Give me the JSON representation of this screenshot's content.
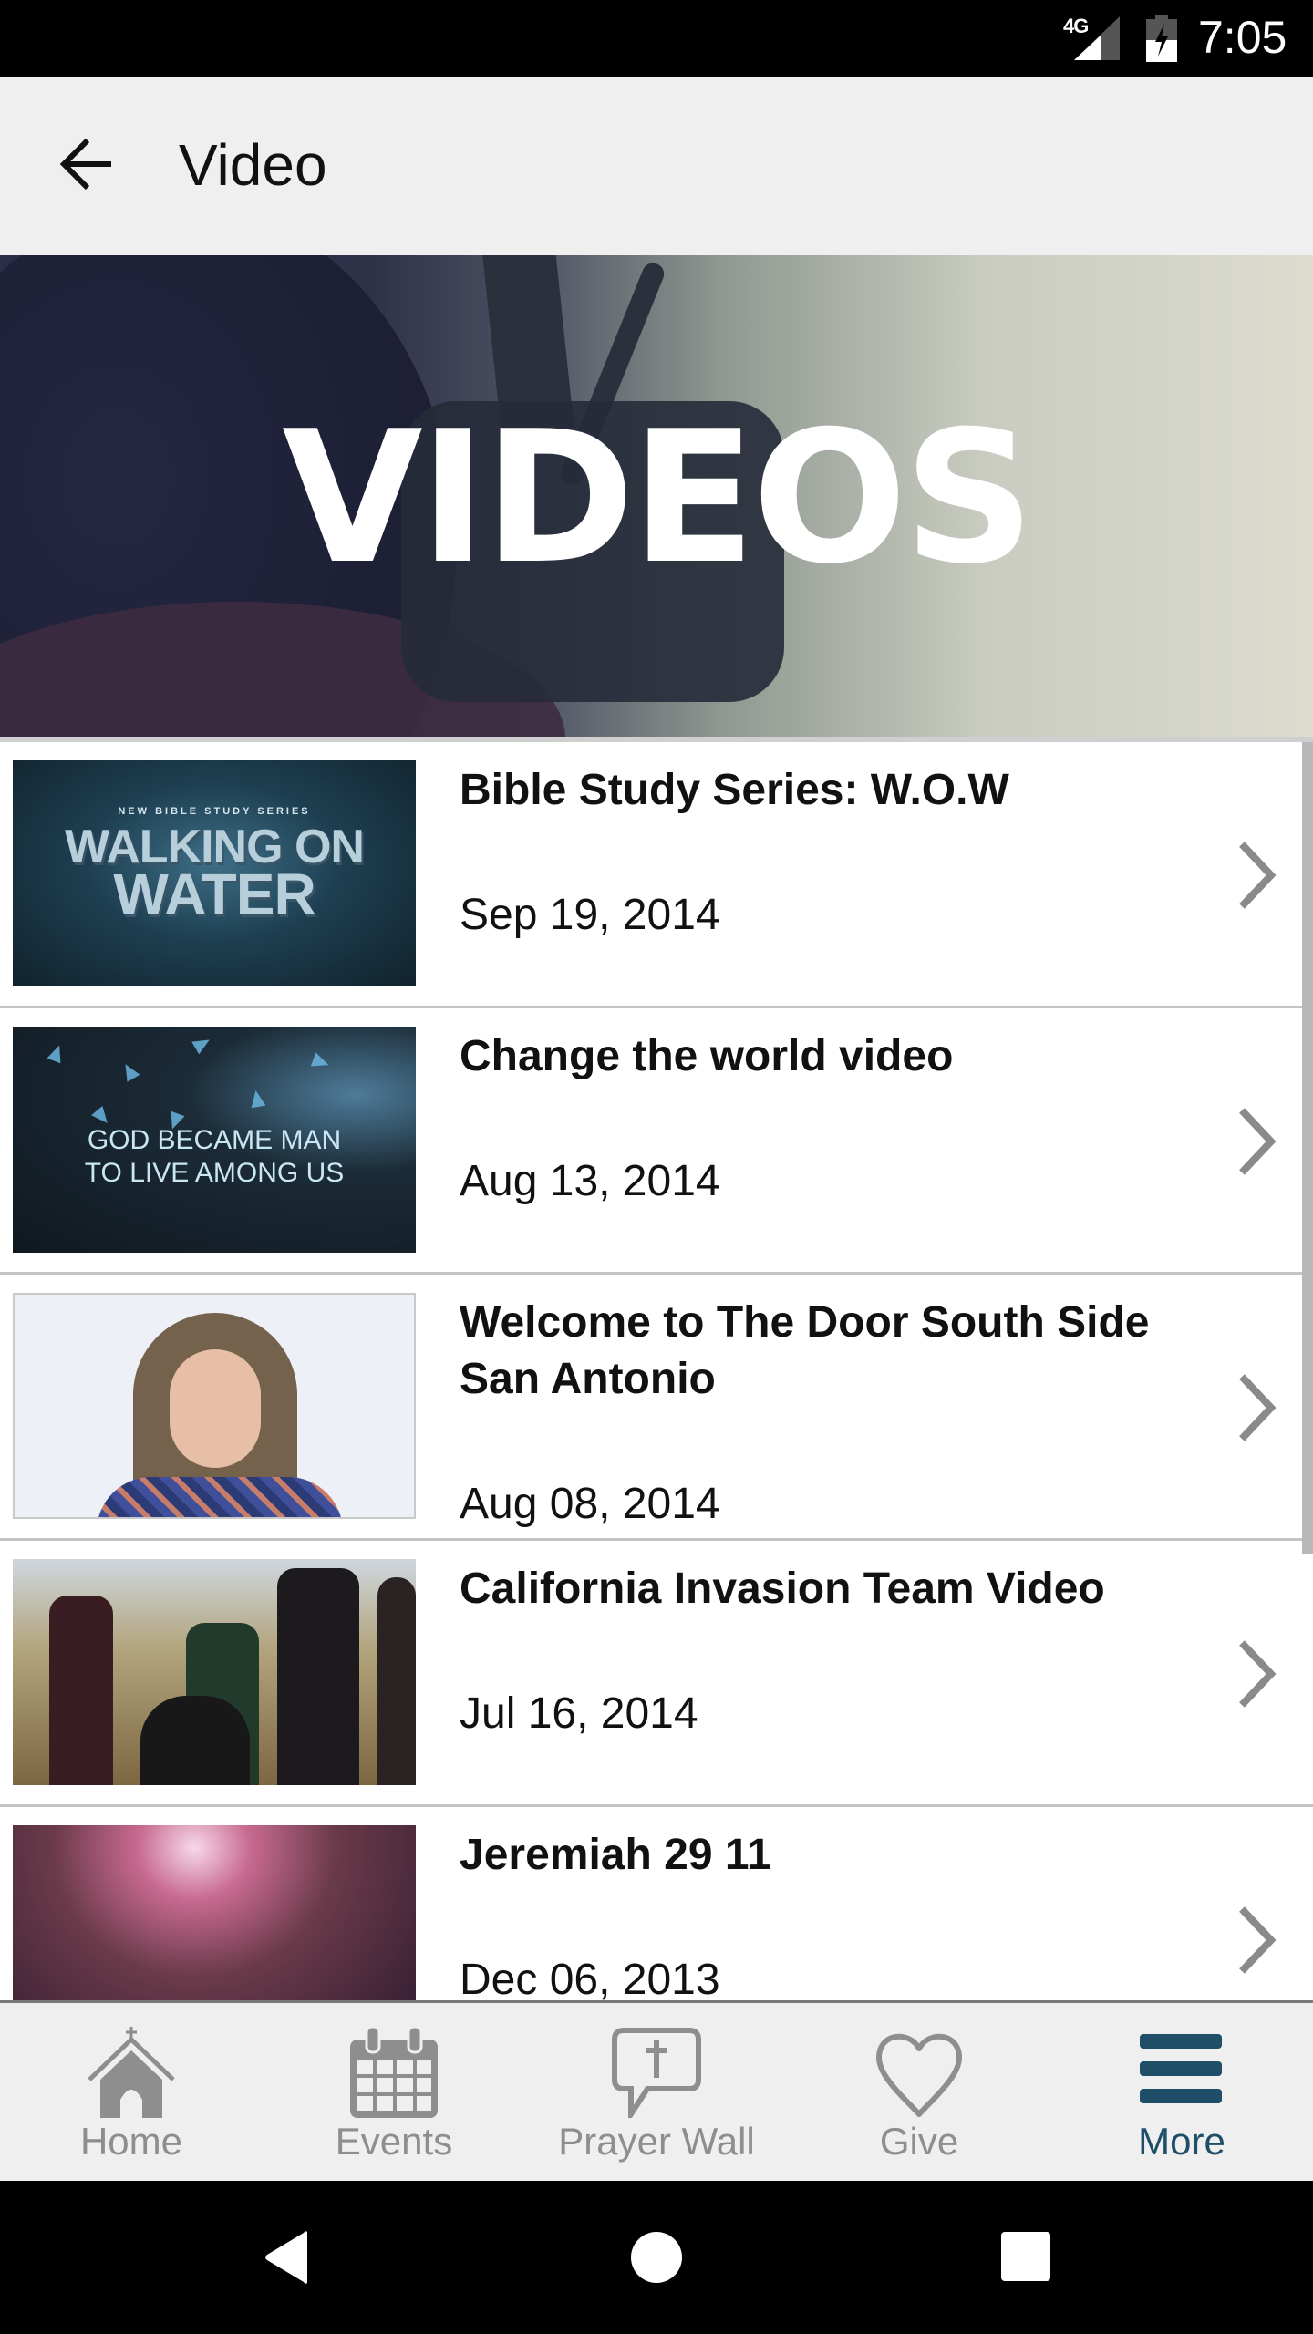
{
  "status_bar": {
    "network": "4G",
    "time": "7:05"
  },
  "app_bar": {
    "back_icon": "arrow-left-icon",
    "title": "Video"
  },
  "banner": {
    "label": "VIDEOS"
  },
  "videos": [
    {
      "title": "Bible Study Series: W.O.W",
      "date": "Sep 19, 2014",
      "thumbnail": {
        "kicker": "NEW BIBLE STUDY SERIES",
        "line1": "WALKING ON",
        "line2": "WATER"
      }
    },
    {
      "title": "Change the world video",
      "date": "Aug 13, 2014",
      "thumbnail": {
        "line1": "GOD BECAME MAN",
        "line2": "TO LIVE AMONG US"
      }
    },
    {
      "title": "Welcome to The Door South Side San Antonio",
      "date": "Aug 08, 2014",
      "thumbnail": {}
    },
    {
      "title": "California Invasion Team Video",
      "date": "Jul 16, 2014",
      "thumbnail": {}
    },
    {
      "title": "Jeremiah 29 11",
      "date": "Dec 06, 2013",
      "thumbnail": {}
    }
  ],
  "bottom_nav": {
    "items": [
      {
        "label": "Home",
        "icon": "church-icon",
        "active": false
      },
      {
        "label": "Events",
        "icon": "calendar-icon",
        "active": false
      },
      {
        "label": "Prayer Wall",
        "icon": "prayer-bubble-icon",
        "active": false
      },
      {
        "label": "Give",
        "icon": "heart-icon",
        "active": false
      },
      {
        "label": "More",
        "icon": "menu-icon",
        "active": true
      }
    ],
    "active_color": "#1f4f68",
    "inactive_color": "#8e8e8e"
  },
  "system_nav": {
    "buttons": [
      "back",
      "home",
      "recents"
    ]
  }
}
